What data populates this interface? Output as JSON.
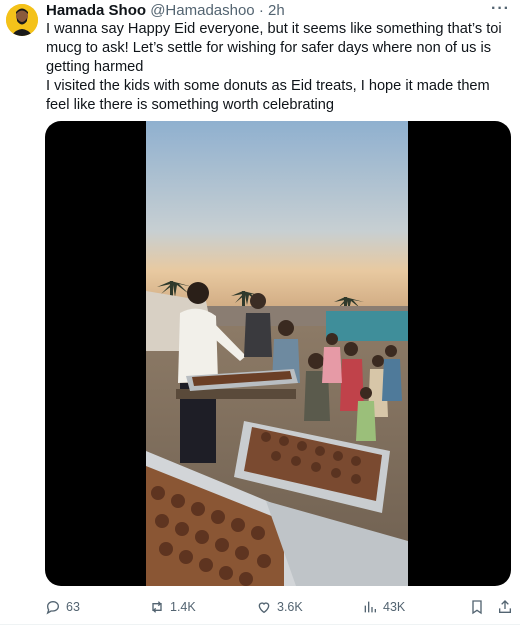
{
  "tweet": {
    "author_name": "Hamada Shoo",
    "handle": "@Hamadashoo",
    "separator": "·",
    "time": "2h",
    "more_label": "···",
    "paragraph_1": "I wanna say Happy Eid everyone, but it seems like something that’s toi mucg to ask! Let’s settle for wishing for safer days where non of us is getting harmed",
    "paragraph_2": "I visited the kids with some donuts as Eid treats, I hope it made them feel like there is something worth celebrating"
  },
  "actions": {
    "replies": "63",
    "reposts": "1.4K",
    "likes": "3.6K",
    "views": "43K"
  },
  "icons": [
    "avatar",
    "more-icon",
    "reply-icon",
    "repost-icon",
    "like-icon",
    "views-icon",
    "bookmark-icon",
    "share-icon"
  ],
  "colors": {
    "text": "#0f1419",
    "muted": "#536471",
    "avatar_bg": "#f4c21a"
  }
}
